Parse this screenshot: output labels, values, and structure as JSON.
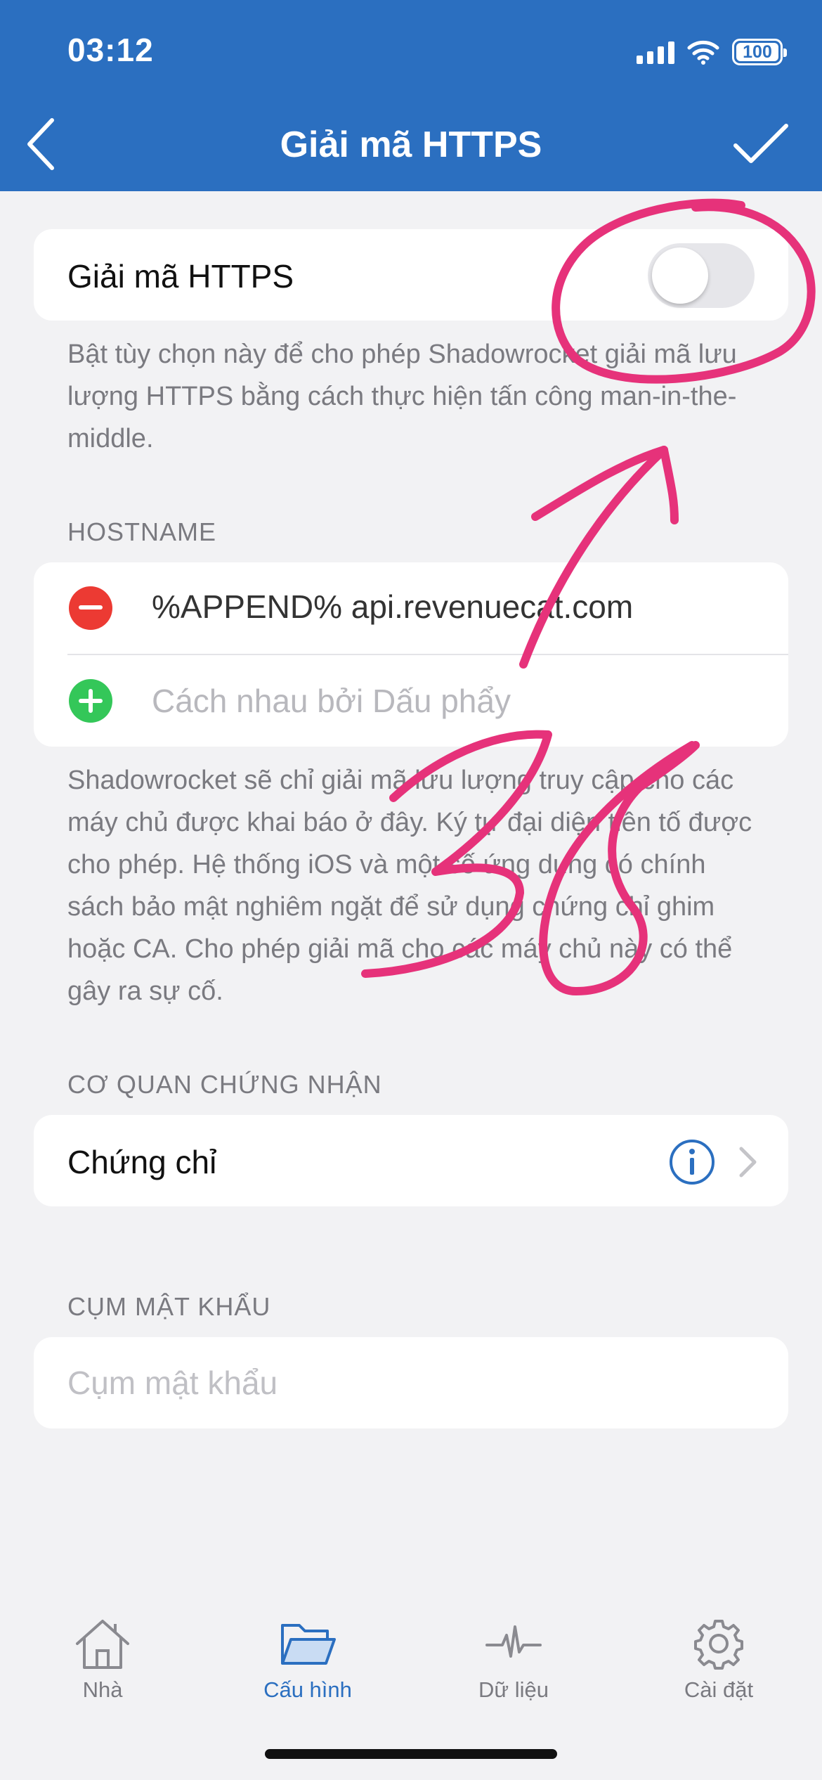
{
  "status_bar": {
    "time": "03:12",
    "battery": "100"
  },
  "nav": {
    "title": "Giải mã HTTPS"
  },
  "decrypt": {
    "label": "Giải mã HTTPS",
    "enabled": false,
    "footnote": "Bật tùy chọn này để cho phép Shadowrocket giải mã lưu lượng HTTPS bằng cách thực hiện tấn công man-in-the-middle."
  },
  "hostname": {
    "header": "HOSTNAME",
    "entries": [
      "%APPEND% api.revenuecat.com"
    ],
    "input_placeholder": "Cách nhau bởi Dấu phẩy",
    "footnote": "Shadowrocket sẽ chỉ giải mã lưu lượng truy cập cho các máy chủ được khai báo ở đây. Ký tự đại diện tiền tố được cho phép. Hệ thống iOS và một số ứng dụng có chính sách bảo mật nghiêm ngặt để sử dụng chứng chỉ ghim hoặc CA. Cho phép giải mã cho các máy chủ này có thể gây ra sự cố."
  },
  "ca": {
    "header": "CƠ QUAN CHỨNG NHẬN",
    "row_label": "Chứng chỉ"
  },
  "passphrase": {
    "header": "CỤM MẬT KHẨU",
    "placeholder": "Cụm mật khẩu"
  },
  "tabs": [
    {
      "label": "Nhà",
      "icon": "house-icon",
      "active": false
    },
    {
      "label": "Cấu hình",
      "icon": "folder-icon",
      "active": true
    },
    {
      "label": "Dữ liệu",
      "icon": "activity-icon",
      "active": false
    },
    {
      "label": "Cài đặt",
      "icon": "gear-icon",
      "active": false
    }
  ],
  "colors": {
    "accent": "#2b6fc0",
    "annotation": "#e6327a",
    "remove": "#ec3a33",
    "add": "#34c759"
  }
}
